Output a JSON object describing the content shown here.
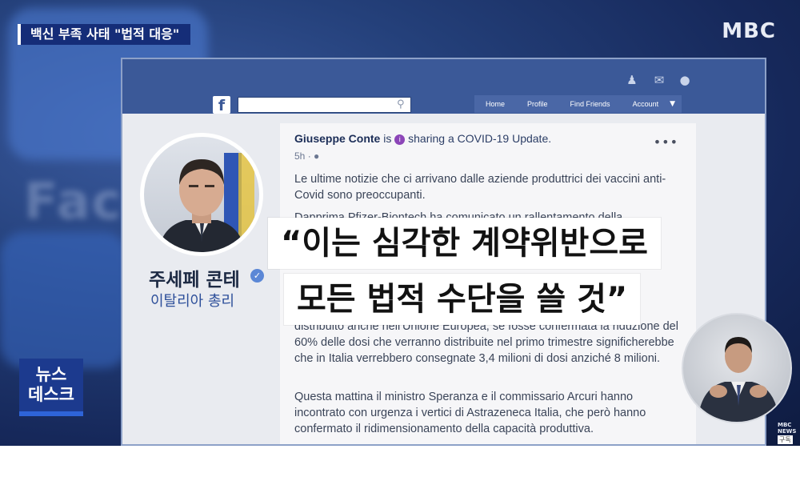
{
  "broadcast": {
    "topic": "백신 부족 사태 \"법적 대응\"",
    "channel_logo": "MBC",
    "background_word": "Face",
    "news_desk": [
      "뉴스",
      "데스크"
    ],
    "small_logo": "MBC NEWS",
    "small_tag": "구독"
  },
  "facebook": {
    "logo": "f",
    "search": {
      "placeholder": ""
    },
    "nav": [
      "Home",
      "Profile",
      "Find Friends",
      "Account"
    ],
    "top_icons": [
      "friends-icon",
      "messages-icon",
      "globe-icon"
    ]
  },
  "profile": {
    "name": "주세페 콘테",
    "role": "이탈리아 총리"
  },
  "post": {
    "author": "Giuseppe Conte",
    "is_text": " is ",
    "activity": " sharing a COVID-19 Update.",
    "time": "5h",
    "menu": "•••",
    "paragraphs": [
      "Le ultime notizie che ci arrivano dalle aziende produttrici dei vaccini anti-Covid sono preoccupanti.",
      "Dapprima Pfizer-Biontech ha comunicato un rallentamento della",
      "distribuito anche nell'Unione Europea, se fosse confermata la riduzione del 60% delle dosi che verranno distribuite nel primo trimestre significherebbe che in Italia verrebbero consegnate 3,4 milioni di dosi anziché 8 milioni.",
      "Questa mattina il ministro Speranza e il commissario Arcuri hanno incontrato con urgenza i vertici di Astrazeneca Italia, che però hanno confermato il ridimensionamento della capacità produttiva."
    ]
  },
  "caption": {
    "line1": "“이는 심각한 계약위반으로",
    "line2": "모든 법적 수단을 쓸 것”"
  },
  "colors": {
    "fb_blue": "#3b5998",
    "topic_bar": "#152d78",
    "name_text": "#1d2a44",
    "role_text": "#2d4f9a"
  }
}
